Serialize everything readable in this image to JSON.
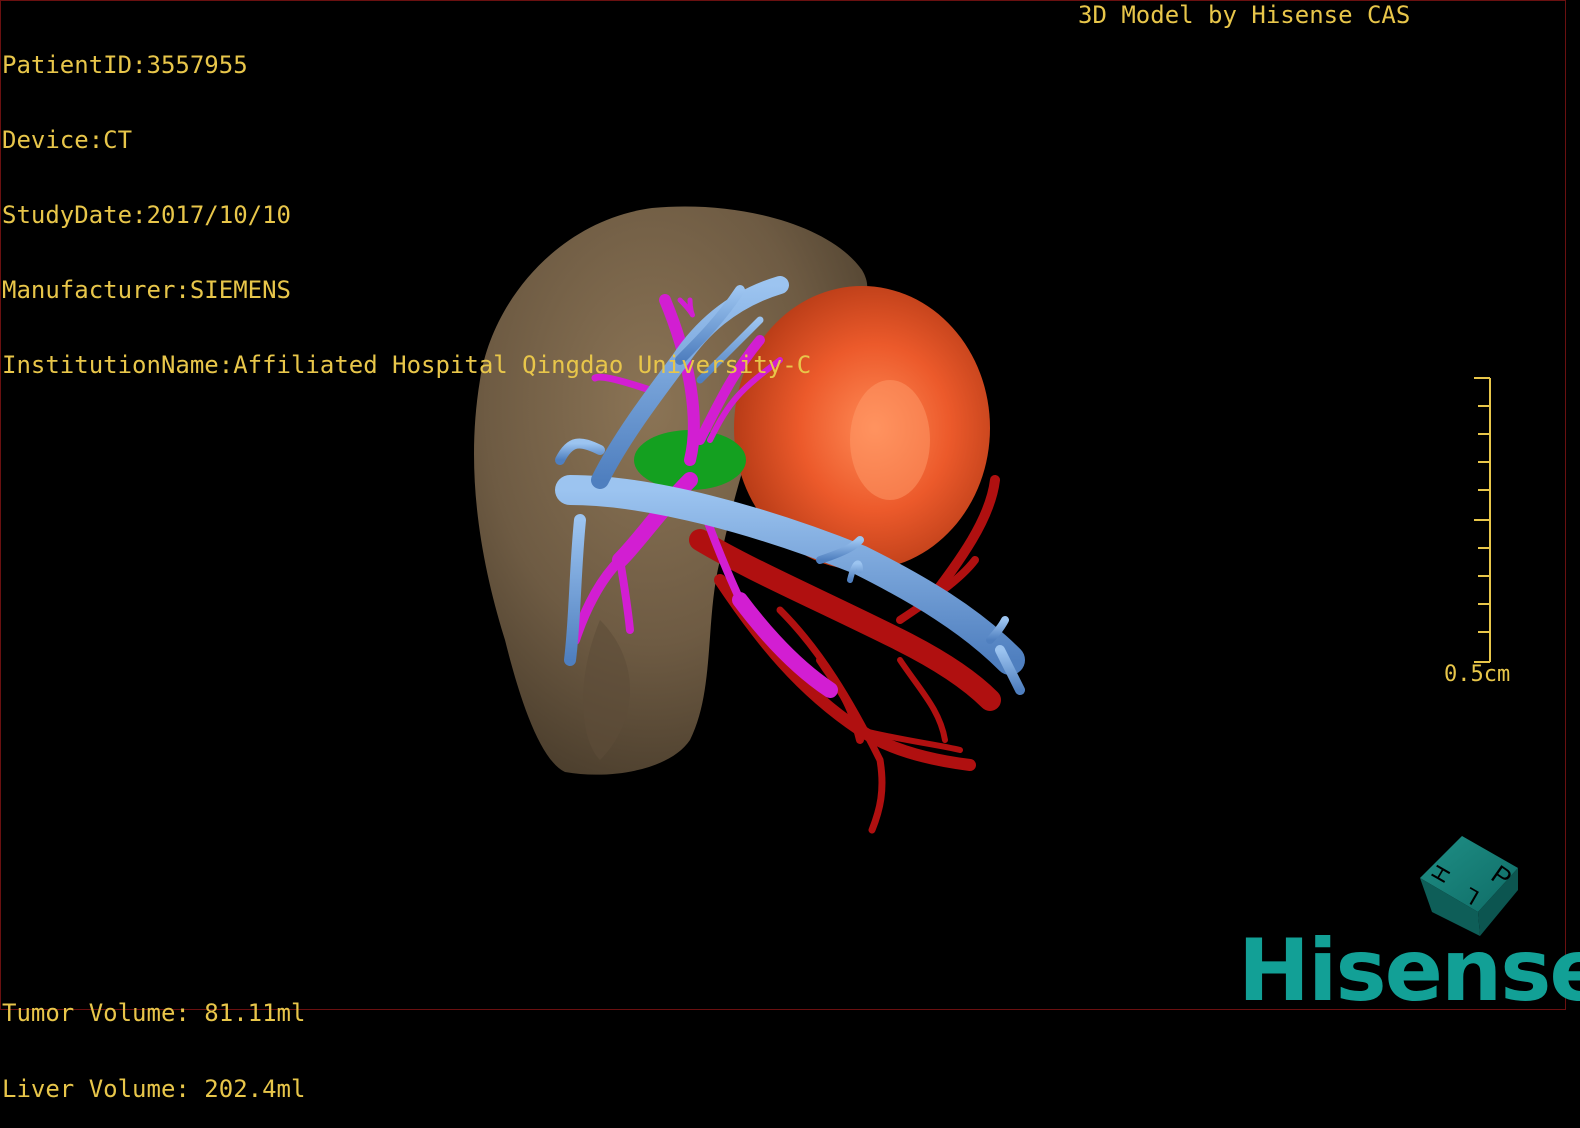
{
  "overlay": {
    "patient_id": "PatientID:3557955",
    "device": "Device:CT",
    "study_date": "StudyDate:2017/10/10",
    "manufacturer": "Manufacturer:SIEMENS",
    "institution": "InstitutionName:Affiliated Hospital Qingdao University-C",
    "model_credit": "3D Model by Hisense CAS"
  },
  "volumes": {
    "tumor": "Tumor Volume: 81.11ml",
    "liver": "Liver Volume: 202.4ml"
  },
  "scale_bar": {
    "label": "0.5cm"
  },
  "orientation_cube": {
    "faces": [
      "P",
      "L",
      "H"
    ]
  },
  "brand": {
    "logo_text": "Hisense"
  },
  "colors": {
    "overlay_text": "#e8c64a",
    "liver": "#7a654a",
    "tumor": "#e0552a",
    "portal_vein": "#6a9bd8",
    "hepatic_vein": "#d21ed2",
    "artery": "#b01010",
    "gallbladder": "#14a020",
    "logo": "#12a096"
  }
}
